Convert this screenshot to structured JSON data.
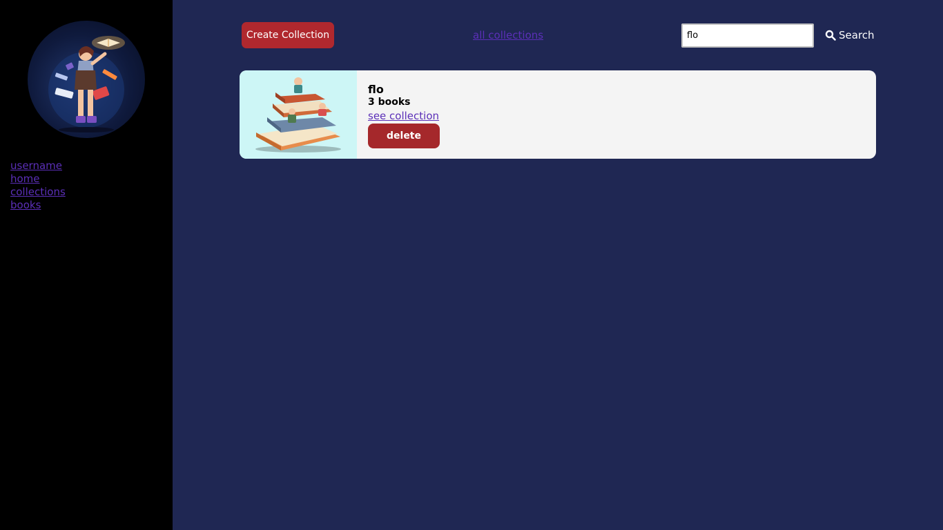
{
  "sidebar": {
    "avatar_icon": "reader-illustration-icon",
    "nav": [
      {
        "label": "username"
      },
      {
        "label": "home"
      },
      {
        "label": "collections"
      },
      {
        "label": "books"
      }
    ]
  },
  "toolbar": {
    "create_label": "Create Collection",
    "all_collections_label": "all collections",
    "search_value": "flo",
    "search_label": "Search",
    "search_icon": "search-icon"
  },
  "collections": [
    {
      "title": "flo",
      "count": "3 books",
      "link_label": "see collection",
      "delete_label": "delete",
      "cover_icon": "book-stack-illustration-icon"
    }
  ],
  "colors": {
    "page_bg": "#1f2753",
    "sidebar_bg": "#000000",
    "accent_red": "#b0282e",
    "link_purple": "#5b2fb8",
    "card_bg": "#f4f4f4",
    "cover_bg": "#cdf6f6"
  }
}
